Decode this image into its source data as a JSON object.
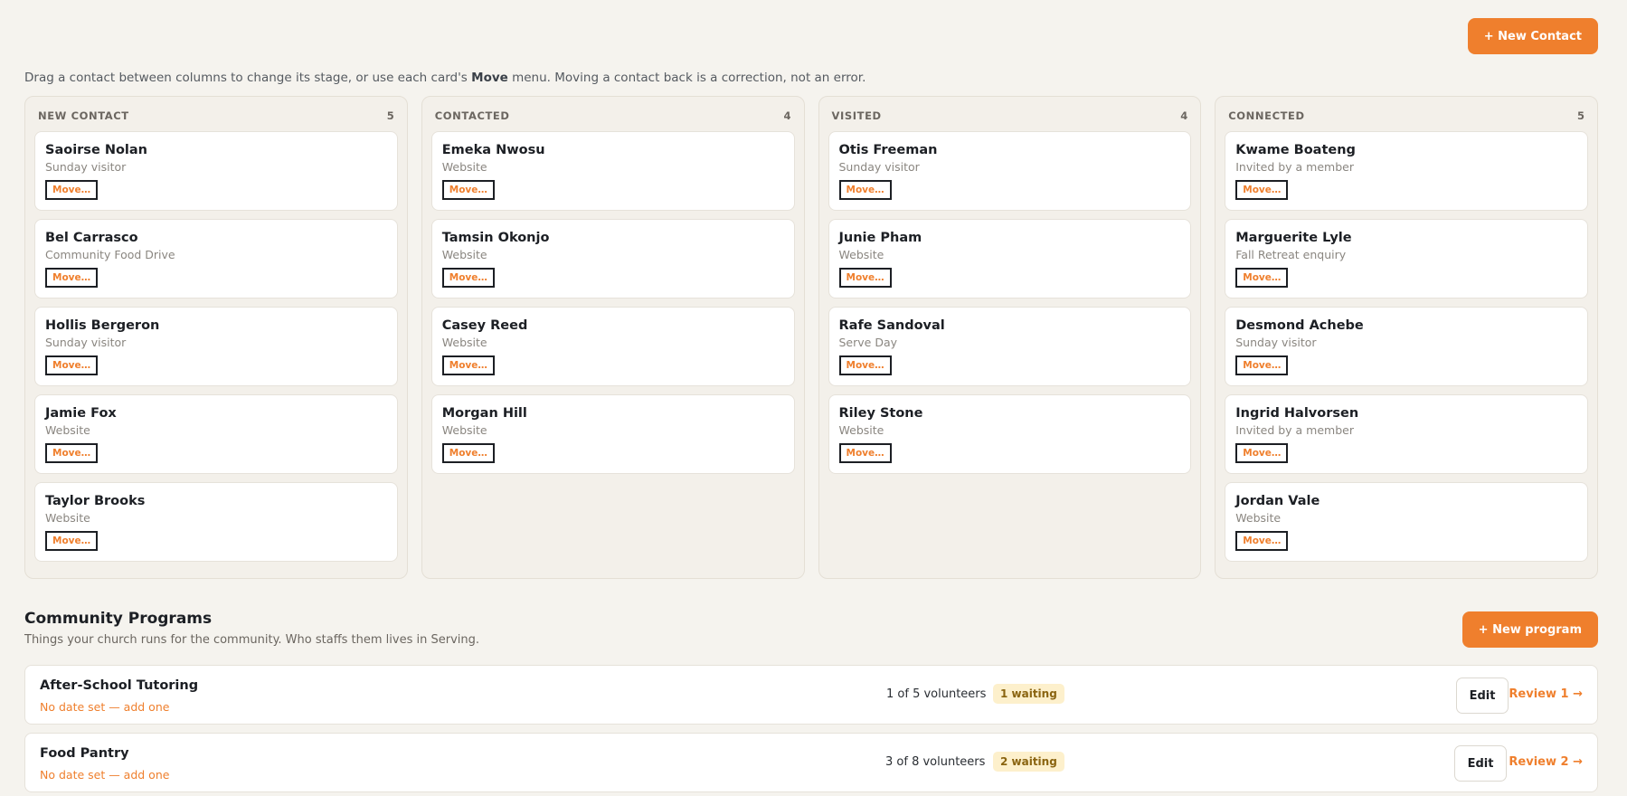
{
  "header": {
    "new_contact_label": "+ New Contact"
  },
  "hint": {
    "before": "Drag a contact between columns to change its stage, or use each card's ",
    "bold": "Move",
    "after": " menu. Moving a contact back is a correction, not an error."
  },
  "move_label": "Move…",
  "columns": [
    {
      "title": "NEW CONTACT",
      "count": "5",
      "cards": [
        {
          "name": "Saoirse Nolan",
          "source": "Sunday visitor"
        },
        {
          "name": "Bel Carrasco",
          "source": "Community Food Drive"
        },
        {
          "name": "Hollis Bergeron",
          "source": "Sunday visitor"
        },
        {
          "name": "Jamie Fox",
          "source": "Website"
        },
        {
          "name": "Taylor Brooks",
          "source": "Website"
        }
      ]
    },
    {
      "title": "CONTACTED",
      "count": "4",
      "cards": [
        {
          "name": "Emeka Nwosu",
          "source": "Website"
        },
        {
          "name": "Tamsin Okonjo",
          "source": "Website"
        },
        {
          "name": "Casey Reed",
          "source": "Website"
        },
        {
          "name": "Morgan Hill",
          "source": "Website"
        }
      ]
    },
    {
      "title": "VISITED",
      "count": "4",
      "cards": [
        {
          "name": "Otis Freeman",
          "source": "Sunday visitor"
        },
        {
          "name": "Junie Pham",
          "source": "Website"
        },
        {
          "name": "Rafe Sandoval",
          "source": "Serve Day"
        },
        {
          "name": "Riley Stone",
          "source": "Website"
        }
      ]
    },
    {
      "title": "CONNECTED",
      "count": "5",
      "cards": [
        {
          "name": "Kwame Boateng",
          "source": "Invited by a member"
        },
        {
          "name": "Marguerite Lyle",
          "source": "Fall Retreat enquiry"
        },
        {
          "name": "Desmond Achebe",
          "source": "Sunday visitor"
        },
        {
          "name": "Ingrid Halvorsen",
          "source": "Invited by a member"
        },
        {
          "name": "Jordan Vale",
          "source": "Website"
        }
      ]
    }
  ],
  "programs": {
    "title": "Community Programs",
    "subtitle": "Things your church runs for the community. Who staffs them lives in Serving.",
    "new_label": "+ New program",
    "edit_label": "Edit",
    "rows": [
      {
        "name": "After-School Tutoring",
        "date": "No date set — add one",
        "volunteers": "1 of 5 volunteers",
        "waiting": "1 waiting",
        "review": "Review 1 →"
      },
      {
        "name": "Food Pantry",
        "date": "No date set — add one",
        "volunteers": "3 of 8 volunteers",
        "waiting": "2 waiting",
        "review": "Review 2 →"
      }
    ]
  }
}
